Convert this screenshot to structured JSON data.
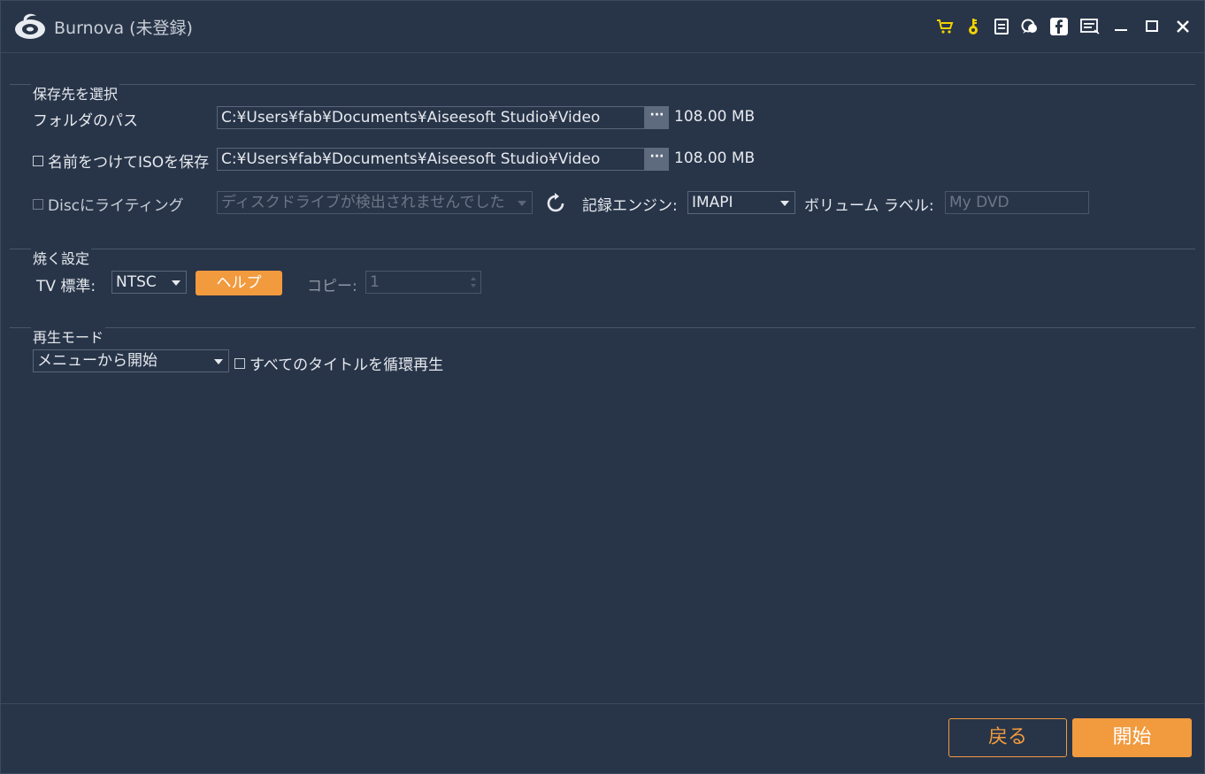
{
  "app": {
    "title": "Burnova (未登録)"
  },
  "toolbar_icons": [
    "cart-icon",
    "key-icon",
    "register-icon",
    "feedback-icon",
    "facebook-icon",
    "menu-icon",
    "minimize-icon",
    "maximize-icon",
    "close-icon"
  ],
  "save": {
    "section_title": "保存先を選択",
    "folder_label": "フォルダのパス",
    "folder_path": "C:¥Users¥fab¥Documents¥Aiseesoft Studio¥Video",
    "folder_size": "108.00 MB",
    "iso_label": "名前をつけてISOを保存",
    "iso_path": "C:¥Users¥fab¥Documents¥Aiseesoft Studio¥Video",
    "iso_size": "108.00 MB",
    "browse_label": "···",
    "disc_label": "Discにライティング",
    "disc_drive": "ディスクドライブが検出されませんでした",
    "engine_label": "記録エンジン:",
    "engine_value": "IMAPI",
    "volume_label": "ボリューム ラベル:",
    "volume_placeholder": "My DVD"
  },
  "burn": {
    "section_title": "焼く設定",
    "tv_label": "TV 標準:",
    "tv_value": "NTSC",
    "help_label": "ヘルプ",
    "copy_label": "コピー:",
    "copy_value": "1"
  },
  "playback": {
    "section_title": "再生モード",
    "mode_value": "メニューから開始",
    "loop_label": "すべてのタイトルを循環再生"
  },
  "footer": {
    "back_label": "戻る",
    "start_label": "開始"
  },
  "colors": {
    "background": "#283549",
    "accent": "#f19a3e",
    "icon_yellow": "#f2d200"
  }
}
